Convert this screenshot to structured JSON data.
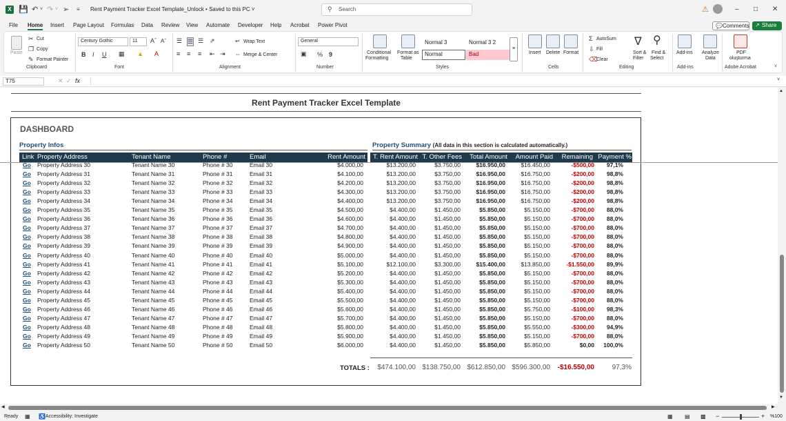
{
  "app": {
    "doc_title": "Rent Payment Tracker Excel Template_Unlock",
    "save_status": "Saved to this PC",
    "search_placeholder": "Search"
  },
  "menu_tabs": [
    "File",
    "Home",
    "Insert",
    "Page Layout",
    "Formulas",
    "Data",
    "Review",
    "View",
    "Automate",
    "Developer",
    "Help",
    "Acrobat",
    "Power Pivot"
  ],
  "header_buttons": {
    "comments": "Comments",
    "share": "Share"
  },
  "ribbon": {
    "clipboard": {
      "paste": "Paste",
      "cut": "Cut",
      "copy": "Copy",
      "format_painter": "Format Painter",
      "group": "Clipboard"
    },
    "font": {
      "name": "Century Gothic",
      "size": "11",
      "group": "Font",
      "bold": "B",
      "italic": "I",
      "underline": "U"
    },
    "alignment": {
      "wrap": "Wrap Text",
      "merge": "Merge & Center",
      "group": "Alignment"
    },
    "number": {
      "format": "General",
      "percent": "%",
      "comma": "9",
      "group": "Number"
    },
    "styles": {
      "conditional": "Conditional",
      "conditional2": "Formatting",
      "format_as": "Format as",
      "format_as2": "Table",
      "normal3": "Normal 3",
      "normal32": "Normal 3 2",
      "normal": "Normal",
      "bad": "Bad",
      "group": "Styles"
    },
    "cells": {
      "insert": "Insert",
      "delete": "Delete",
      "format": "Format",
      "group": "Cells"
    },
    "editing": {
      "autosum": "AutoSum",
      "fill": "Fill",
      "clear": "Clear",
      "sort": "Sort &",
      "sort2": "Filter",
      "find": "Find &",
      "find2": "Select",
      "group": "Editing"
    },
    "addins": {
      "addins": "Add-ins",
      "analyze": "Analyze",
      "analyze2": "Data",
      "group": "Add-ins"
    },
    "acrobat": {
      "pdf": "PDF",
      "pdf2": "oluşturma",
      "group": "Adobe Acrobat"
    }
  },
  "formula_bar": {
    "name_box": "T75",
    "fx": "fx",
    "value": ""
  },
  "sheet": {
    "title": "Rent Payment Tracker Excel Template",
    "dashboard": "DASHBOARD",
    "property_infos": "Property Infos",
    "property_summary": "Property Summary",
    "summary_note": "(All data in this section is calculated automatically.)",
    "headers": [
      "Link",
      "Property Address",
      "Tenant Name",
      "Phone #",
      "Email",
      "Rent Amount",
      "T. Rent Amount",
      "T. Other Fees",
      "Total Amount",
      "Amount Paid",
      "Remaining",
      "Payment %"
    ],
    "rows": [
      [
        "Go",
        "Property Address 30",
        "Tenant Name 30",
        "Phone # 30",
        "Email 30",
        "$4.000,00",
        "$13.200,00",
        "$3.750,00",
        "$16.950,00",
        "$16.450,00",
        "-$500,00",
        "97,1%"
      ],
      [
        "Go",
        "Property Address 31",
        "Tenant Name 31",
        "Phone # 31",
        "Email 31",
        "$4.100,00",
        "$13.200,00",
        "$3.750,00",
        "$16.950,00",
        "$16.750,00",
        "-$200,00",
        "98,8%"
      ],
      [
        "Go",
        "Property Address 32",
        "Tenant Name 32",
        "Phone # 32",
        "Email 32",
        "$4.200,00",
        "$13.200,00",
        "$3.750,00",
        "$16.950,00",
        "$16.750,00",
        "-$200,00",
        "98,8%"
      ],
      [
        "Go",
        "Property Address 33",
        "Tenant Name 33",
        "Phone # 33",
        "Email 33",
        "$4.300,00",
        "$13.200,00",
        "$3.750,00",
        "$16.950,00",
        "$16.750,00",
        "-$200,00",
        "98,8%"
      ],
      [
        "Go",
        "Property Address 34",
        "Tenant Name 34",
        "Phone # 34",
        "Email 34",
        "$4.400,00",
        "$13.200,00",
        "$3.750,00",
        "$16.950,00",
        "$16.750,00",
        "-$200,00",
        "98,8%"
      ],
      [
        "Go",
        "Property Address 35",
        "Tenant Name 35",
        "Phone # 35",
        "Email 35",
        "$4.500,00",
        "$4.400,00",
        "$1.450,00",
        "$5.850,00",
        "$5.150,00",
        "-$700,00",
        "88,0%"
      ],
      [
        "Go",
        "Property Address 36",
        "Tenant Name 36",
        "Phone # 36",
        "Email 36",
        "$4.600,00",
        "$4.400,00",
        "$1.450,00",
        "$5.850,00",
        "$5.150,00",
        "-$700,00",
        "88,0%"
      ],
      [
        "Go",
        "Property Address 37",
        "Tenant Name 37",
        "Phone # 37",
        "Email 37",
        "$4.700,00",
        "$4.400,00",
        "$1.450,00",
        "$5.850,00",
        "$5.150,00",
        "-$700,00",
        "88,0%"
      ],
      [
        "Go",
        "Property Address 38",
        "Tenant Name 38",
        "Phone # 38",
        "Email 38",
        "$4.800,00",
        "$4.400,00",
        "$1.450,00",
        "$5.850,00",
        "$5.150,00",
        "-$700,00",
        "88,0%"
      ],
      [
        "Go",
        "Property Address 39",
        "Tenant Name 39",
        "Phone # 39",
        "Email 39",
        "$4.900,00",
        "$4.400,00",
        "$1.450,00",
        "$5.850,00",
        "$5.150,00",
        "-$700,00",
        "88,0%"
      ],
      [
        "Go",
        "Property Address 40",
        "Tenant Name 40",
        "Phone # 40",
        "Email 40",
        "$5.000,00",
        "$4.400,00",
        "$1.450,00",
        "$5.850,00",
        "$5.150,00",
        "-$700,00",
        "88,0%"
      ],
      [
        "Go",
        "Property Address 41",
        "Tenant Name 41",
        "Phone # 41",
        "Email 41",
        "$5.100,00",
        "$12.100,00",
        "$3.300,00",
        "$15.400,00",
        "$13.850,00",
        "-$1.550,00",
        "89,9%"
      ],
      [
        "Go",
        "Property Address 42",
        "Tenant Name 42",
        "Phone # 42",
        "Email 42",
        "$5.200,00",
        "$4.400,00",
        "$1.450,00",
        "$5.850,00",
        "$5.150,00",
        "-$700,00",
        "88,0%"
      ],
      [
        "Go",
        "Property Address 43",
        "Tenant Name 43",
        "Phone # 43",
        "Email 43",
        "$5.300,00",
        "$4.400,00",
        "$1.450,00",
        "$5.850,00",
        "$5.150,00",
        "-$700,00",
        "88,0%"
      ],
      [
        "Go",
        "Property Address 44",
        "Tenant Name 44",
        "Phone # 44",
        "Email 44",
        "$5.400,00",
        "$4.400,00",
        "$1.450,00",
        "$5.850,00",
        "$5.150,00",
        "-$700,00",
        "88,0%"
      ],
      [
        "Go",
        "Property Address 45",
        "Tenant Name 45",
        "Phone # 45",
        "Email 45",
        "$5.500,00",
        "$4.400,00",
        "$1.450,00",
        "$5.850,00",
        "$5.150,00",
        "-$700,00",
        "88,0%"
      ],
      [
        "Go",
        "Property Address 46",
        "Tenant Name 46",
        "Phone # 46",
        "Email 46",
        "$5.600,00",
        "$4.400,00",
        "$1.450,00",
        "$5.850,00",
        "$5.750,00",
        "-$100,00",
        "98,3%"
      ],
      [
        "Go",
        "Property Address 47",
        "Tenant Name 47",
        "Phone # 47",
        "Email 47",
        "$5.700,00",
        "$4.400,00",
        "$1.450,00",
        "$5.850,00",
        "$5.150,00",
        "-$700,00",
        "88,0%"
      ],
      [
        "Go",
        "Property Address 48",
        "Tenant Name 48",
        "Phone # 48",
        "Email 48",
        "$5.800,00",
        "$4.400,00",
        "$1.450,00",
        "$5.850,00",
        "$5.550,00",
        "-$300,00",
        "94,9%"
      ],
      [
        "Go",
        "Property Address 49",
        "Tenant Name 49",
        "Phone # 49",
        "Email 49",
        "$5.900,00",
        "$4.400,00",
        "$1.450,00",
        "$5.850,00",
        "$5.150,00",
        "-$700,00",
        "88,0%"
      ],
      [
        "Go",
        "Property Address 50",
        "Tenant Name 50",
        "Phone # 50",
        "Email 50",
        "$6.000,00",
        "$4.400,00",
        "$1.450,00",
        "$5.850,00",
        "$5.850,00",
        "$0,00",
        "100,0%"
      ]
    ],
    "totals_label": "TOTALS :",
    "totals": [
      "$474.100,00",
      "$138.750,00",
      "$612.850,00",
      "$596.300,00",
      "-$16.550,00",
      "97,3%"
    ]
  },
  "status": {
    "ready": "Ready",
    "accessibility": "Accessibility: Investigate",
    "zoom": "%100"
  },
  "colors": {
    "header_bg": "#1f3a4d",
    "excel_green": "#217346",
    "negative": "#c00000",
    "link": "#1f4e79"
  }
}
